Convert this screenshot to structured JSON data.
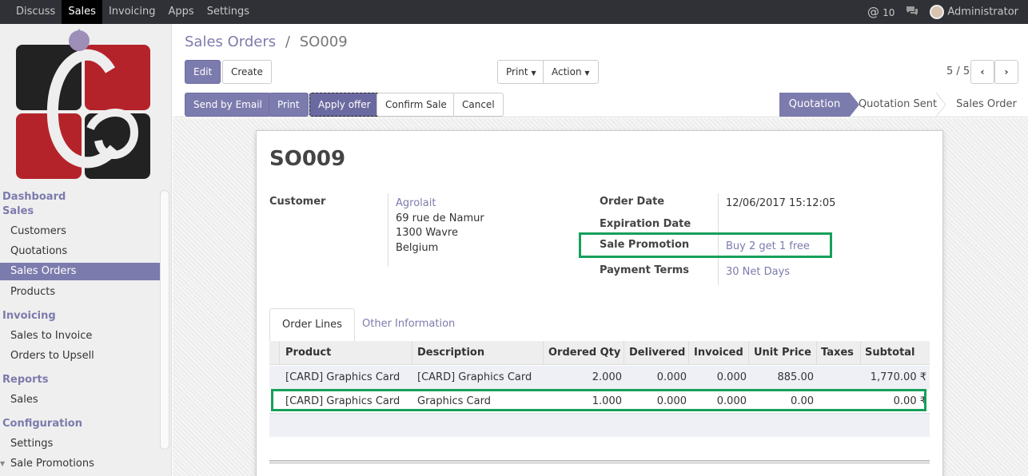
{
  "topbar": {
    "menu": [
      "Discuss",
      "Sales",
      "Invoicing",
      "Apps",
      "Settings"
    ],
    "active_menu": "Sales",
    "mentions_count": "10",
    "user": "Administrator"
  },
  "sidebar": {
    "sections": {
      "dashboard": "Dashboard",
      "sales": "Sales",
      "invoicing": "Invoicing",
      "reports": "Reports",
      "configuration": "Configuration"
    },
    "items": {
      "customers": "Customers",
      "quotations": "Quotations",
      "sales_orders": "Sales Orders",
      "products": "Products",
      "sales_to_invoice": "Sales to Invoice",
      "orders_to_upsell": "Orders to Upsell",
      "reports_sales": "Sales",
      "settings": "Settings",
      "sale_promotions": "Sale Promotions"
    },
    "active_item": "Sales Orders"
  },
  "breadcrumb": {
    "parent": "Sales Orders",
    "separator": "/",
    "current": "SO009"
  },
  "toolbar": {
    "edit": "Edit",
    "create": "Create",
    "print": "Print",
    "action": "Action",
    "pager": "5 / 5"
  },
  "statusbar": {
    "send_email": "Send by Email",
    "print": "Print",
    "apply_offer": "Apply offer",
    "confirm_sale": "Confirm Sale",
    "cancel": "Cancel",
    "stages": [
      "Quotation",
      "Quotation Sent",
      "Sales Order"
    ],
    "current_stage": "Quotation"
  },
  "form": {
    "title": "SO009",
    "customer_label": "Customer",
    "customer_name": "Agrolait",
    "customer_address": [
      "69 rue de Namur",
      "1300 Wavre",
      "Belgium"
    ],
    "order_date_label": "Order Date",
    "order_date": "12/06/2017 15:12:05",
    "expiration_label": "Expiration Date",
    "promotion_label": "Sale Promotion",
    "promotion_value": "Buy 2 get 1 free",
    "payment_terms_label": "Payment Terms",
    "payment_terms_value": "30 Net Days"
  },
  "tabs": [
    "Order Lines",
    "Other Information"
  ],
  "order_lines": {
    "columns": [
      "Product",
      "Description",
      "Ordered Qty",
      "Delivered",
      "Invoiced",
      "Unit Price",
      "Taxes",
      "Subtotal"
    ],
    "rows": [
      [
        "[CARD] Graphics Card",
        "[CARD] Graphics Card",
        "2.000",
        "0.000",
        "0.000",
        "885.00",
        "",
        "1,770.00 ₹"
      ],
      [
        "[CARD] Graphics Card",
        "Graphics Card",
        "1.000",
        "0.000",
        "0.000",
        "0.00",
        "",
        "0.00 ₹"
      ]
    ]
  },
  "colors": {
    "brand": "#7c7bad",
    "highlight": "#16a05b",
    "topbar": "#2f3136"
  },
  "icons": [
    "at-icon",
    "chat-icon",
    "chevron-left-icon",
    "chevron-right-icon",
    "caret-down-icon"
  ]
}
